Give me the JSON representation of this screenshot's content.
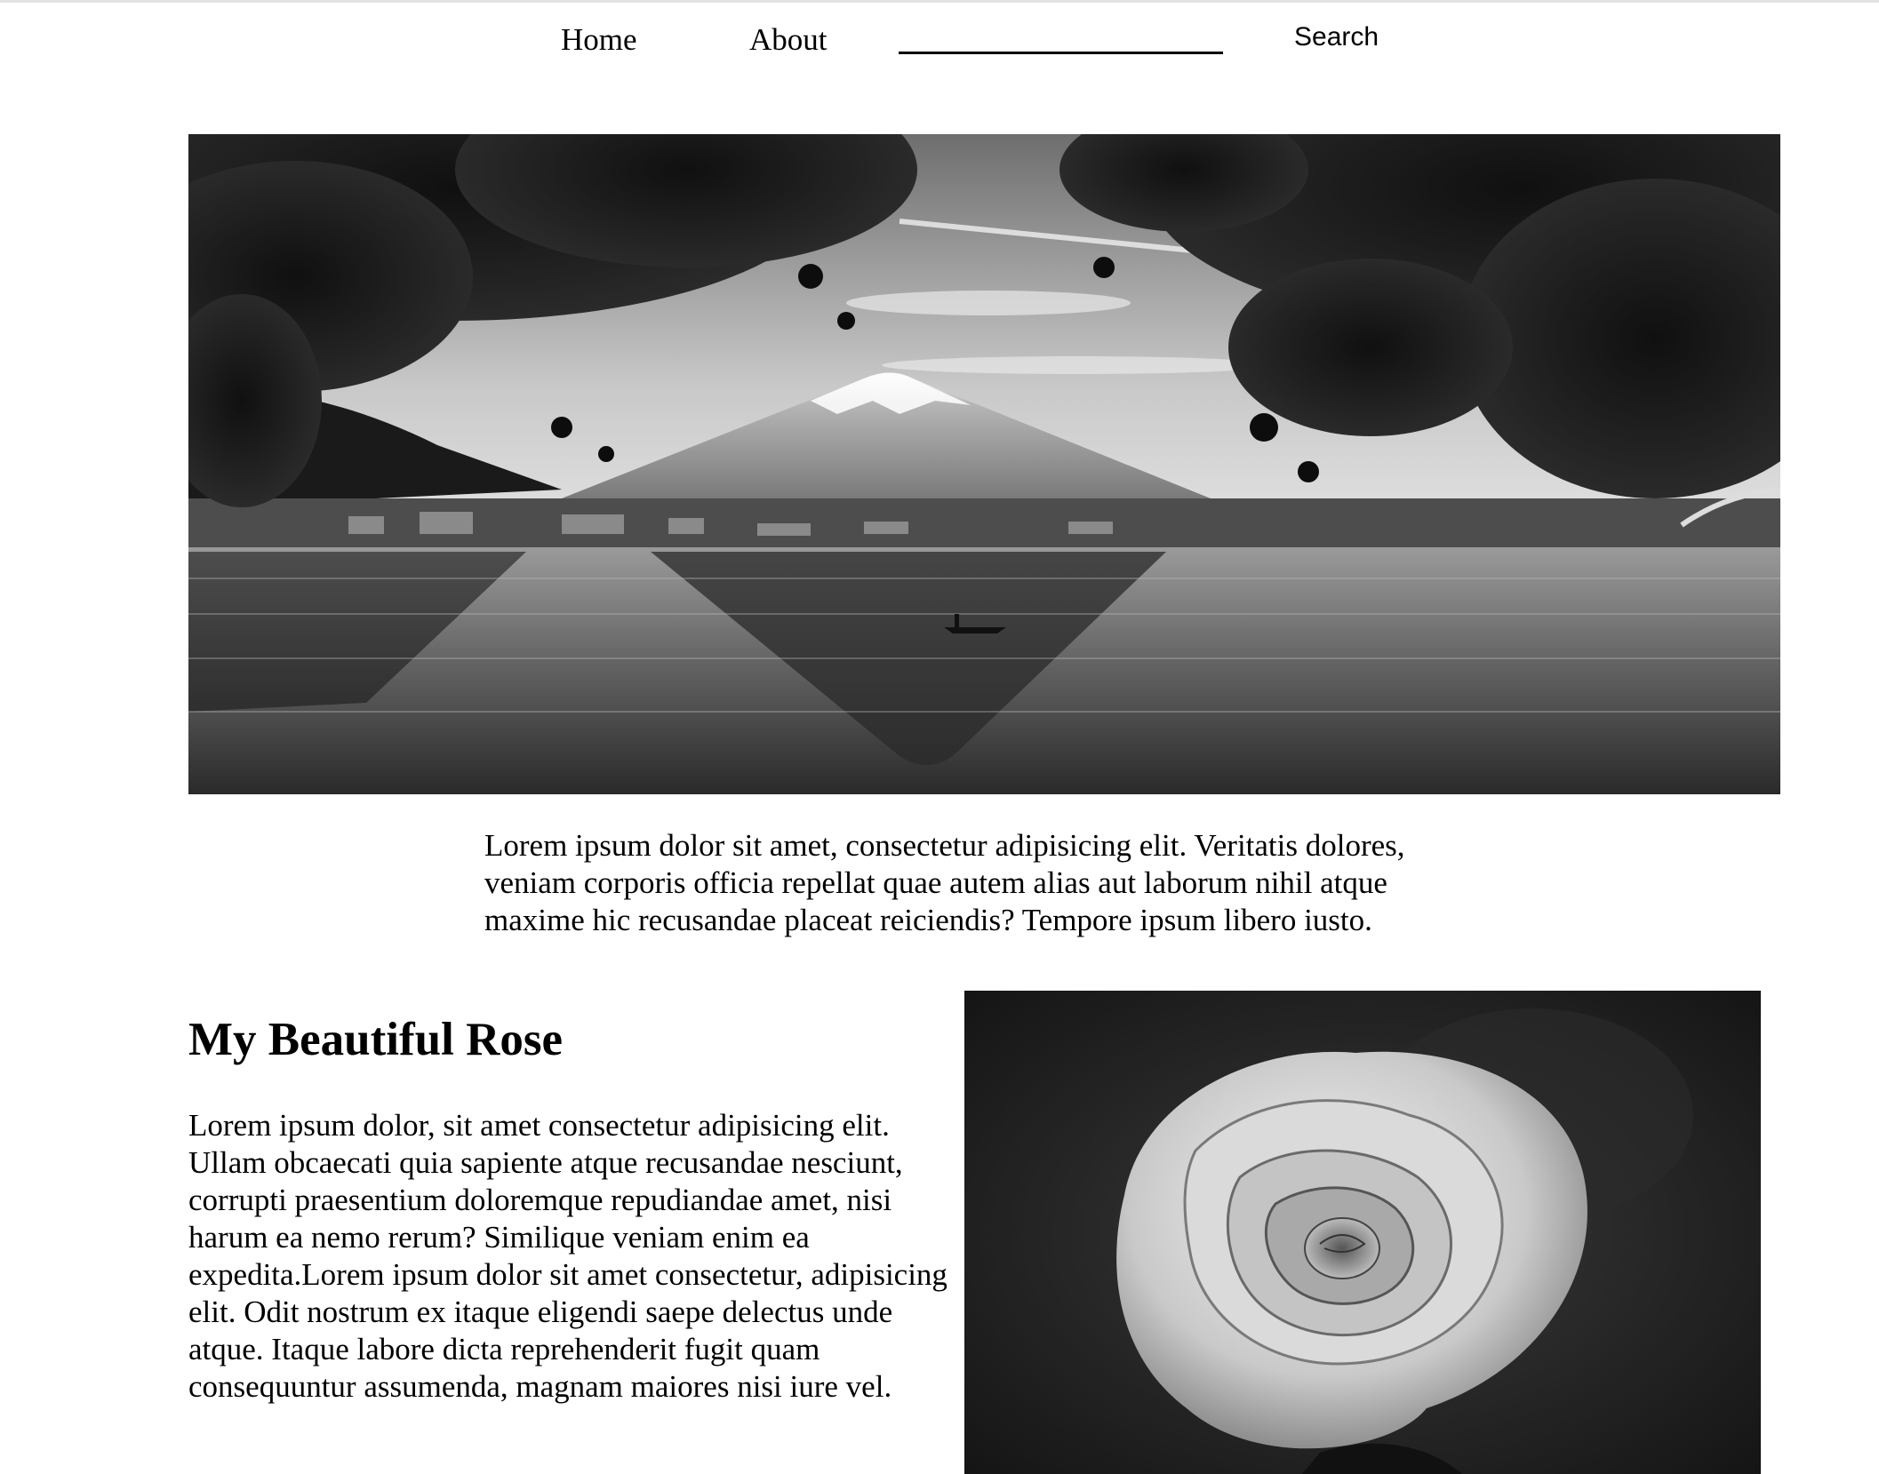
{
  "nav": {
    "home_label": "Home",
    "about_label": "About",
    "search_value": "",
    "search_button_label": "Search"
  },
  "hero": {
    "caption": "Lorem ipsum dolor sit amet, consectetur adipisicing elit. Veritatis dolores, veniam corporis officia repellat quae autem alias aut laborum nihil atque maxime hic recusandae placeat reiciendis? Tempore ipsum libero iusto."
  },
  "rose_section": {
    "title": "My Beautiful Rose",
    "body": "Lorem ipsum dolor, sit amet consectetur adipisicing elit. Ullam obcaecati quia sapiente atque recusandae nesciunt, corrupti praesentium doloremque repudiandae amet, nisi harum ea nemo rerum? Similique veniam enim ea expedita.Lorem ipsum dolor sit amet consectetur, adipisicing elit. Odit nostrum ex itaque eligendi saepe delectus unde atque. Itaque labore dicta reprehenderit fugit quam consequuntur assumenda, magnam maiores nisi iure vel."
  },
  "colors": {
    "text": "#000000",
    "background": "#ffffff",
    "search_underline": "#000000"
  }
}
